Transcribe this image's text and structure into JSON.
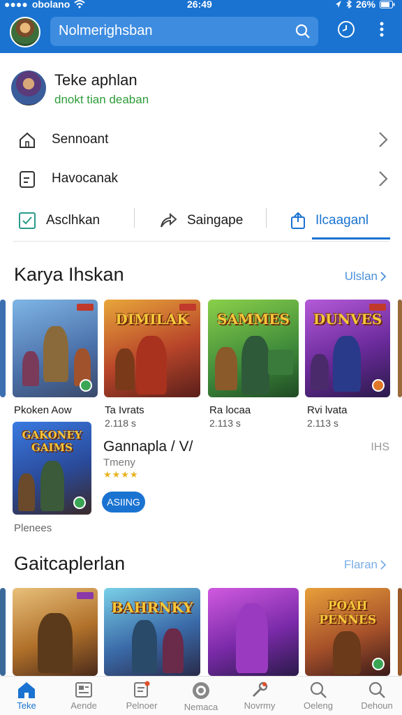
{
  "status": {
    "carrier": "obolano",
    "time": "26:49",
    "battery": "26%"
  },
  "header": {
    "search_placeholder": "Nolmerighsban"
  },
  "profile": {
    "name": "Teke aphlan",
    "subtitle": "dnokt tian deaban"
  },
  "menu": [
    {
      "label": "Sennoant",
      "icon": "home-icon"
    },
    {
      "label": "Havocanak",
      "icon": "document-icon"
    }
  ],
  "tabs": [
    {
      "label": "Asclhkan",
      "icon": "check-square-icon"
    },
    {
      "label": "Saingape",
      "icon": "share-icon"
    },
    {
      "label": "Ilcaaganl",
      "icon": "upload-icon",
      "active": true
    }
  ],
  "section1": {
    "title": "Karya Ihskan",
    "more": "Ulslan",
    "games": [
      {
        "banner": "",
        "name": "Pkoken Aow",
        "size": ""
      },
      {
        "banner": "DIMILAK",
        "name": "Ta Ivrats",
        "size": "2.118 s"
      },
      {
        "banner": "SAMMES",
        "name": "Ra locaa",
        "size": "2.113 s"
      },
      {
        "banner": "DUNVES",
        "name": "Rvi lvata",
        "size": "2.113 s"
      }
    ],
    "featured": {
      "banner": "GAKONEY GAIMS",
      "title": "Gannapla / V/",
      "subtitle": "Tmeny",
      "stars": "★★★★",
      "button": "ASIING",
      "right": "IHS",
      "under": "Plenees"
    }
  },
  "section2": {
    "title": "Gaitcaplerlan",
    "more": "Flaran",
    "games": [
      {
        "banner": ""
      },
      {
        "banner": "BAHRNKY"
      },
      {
        "banner": ""
      },
      {
        "banner": "POAH PENNES"
      }
    ]
  },
  "bottom_nav": [
    {
      "label": "Teke",
      "icon": "home-icon",
      "active": true
    },
    {
      "label": "Aende",
      "icon": "newspaper-icon"
    },
    {
      "label": "Pelnoer",
      "icon": "notes-icon"
    },
    {
      "label": "Nemaca",
      "icon": "circle-icon"
    },
    {
      "label": "Novrmy",
      "icon": "tools-icon"
    },
    {
      "label": "Oeleng",
      "icon": "search-icon"
    },
    {
      "label": "Dehoun",
      "icon": "search-icon"
    }
  ],
  "colors": {
    "primary": "#1a73d1",
    "accent_green": "#2e9b3a",
    "star": "#e8b321"
  }
}
